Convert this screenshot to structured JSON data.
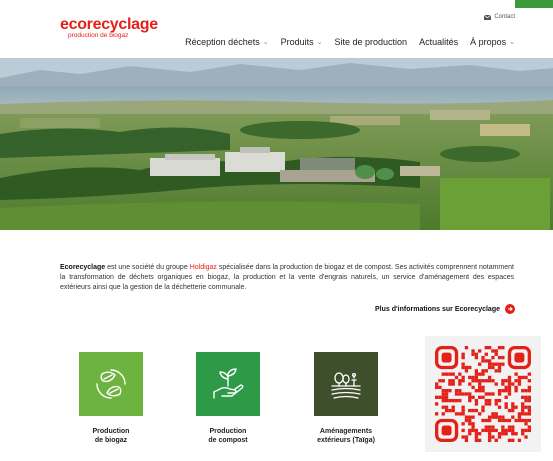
{
  "logo": {
    "name": "ecorecyclage",
    "tagline": "production de biogaz"
  },
  "header": {
    "contact_label": "Contact"
  },
  "nav": {
    "items": [
      {
        "label": "Réception déchets"
      },
      {
        "label": "Produits"
      },
      {
        "label": "Site de production"
      },
      {
        "label": "Actualités"
      },
      {
        "label": "À propos"
      }
    ]
  },
  "intro": {
    "company": "Ecorecyclage",
    "text_1": " est une société du groupe ",
    "group": "Holdigaz",
    "text_2": " spécialisée dans la production de biogaz et de compost. Ses activités comprennent notamment la transformation de déchets organiques en biogaz, la production et la vente d'engrais naturels, un service d'aménagement des espaces extérieurs ainsi que la gestion de la déchetterie communale."
  },
  "more_link": {
    "label": "Plus d'informations sur Ecorecyclage"
  },
  "services": [
    {
      "line1": "Production",
      "line2": "de biogaz",
      "icon": "leaf-cycle-icon",
      "color": "#6db33f"
    },
    {
      "line1": "Production",
      "line2": "de compost",
      "icon": "hand-plant-icon",
      "color": "#2e9a47"
    },
    {
      "line1": "Aménagements",
      "line2": "extérieurs (Taïga)",
      "icon": "landscape-icon",
      "color": "#3e4f2c"
    }
  ],
  "colors": {
    "brand_red": "#e32119",
    "accent_green": "#3a9a3a"
  }
}
